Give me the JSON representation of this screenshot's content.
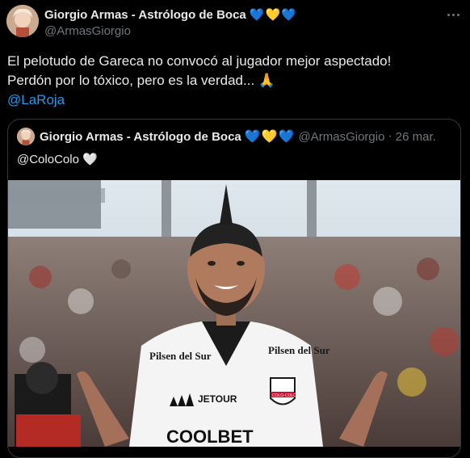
{
  "tweet": {
    "author_name": "Giorgio Armas - Astrólogo de Boca",
    "author_handle": "@ArmasGiorgio",
    "hearts": [
      "💙",
      "💛",
      "💙"
    ],
    "body_line1": "El pelotudo de Gareca no convocó al jugador mejor aspectado!",
    "body_line2": "Perdón por lo tóxico, pero es la verdad... 🙏",
    "mention": "@LaRoja"
  },
  "quoted": {
    "author_name": "Giorgio Armas - Astrólogo de Boca",
    "hearts": [
      "💙",
      "💛",
      "💙"
    ],
    "author_handle": "@ArmasGiorgio",
    "separator": "·",
    "date": "26 mar.",
    "text": "@ColoColo 🤍"
  },
  "media": {
    "shirt_sponsor1": "Pilsen del Sur",
    "shirt_sponsor2": "Pilsen del Sur",
    "shirt_brand": "JETOUR",
    "shirt_bottom": "COOLBET",
    "crest": "COLO-COLO"
  },
  "icons": {
    "more": "more-options-icon"
  }
}
